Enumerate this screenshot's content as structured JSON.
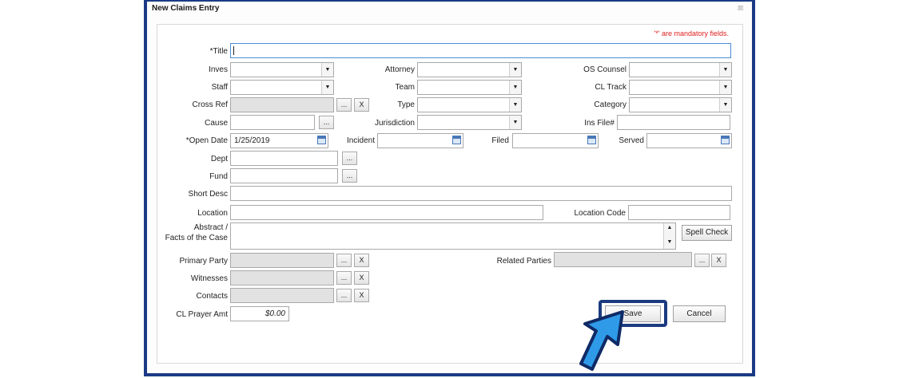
{
  "window": {
    "title": "New Claims Entry",
    "close_glyph": "☒"
  },
  "mandatory_note": "'*' are mandatory fields.",
  "fields": {
    "title": {
      "label": "*Title",
      "value": ""
    },
    "inves": {
      "label": "Inves"
    },
    "attorney": {
      "label": "Attorney"
    },
    "os_counsel": {
      "label": "OS Counsel"
    },
    "staff": {
      "label": "Staff"
    },
    "team": {
      "label": "Team"
    },
    "cl_track": {
      "label": "CL Track"
    },
    "cross_ref": {
      "label": "Cross Ref"
    },
    "type": {
      "label": "Type"
    },
    "category": {
      "label": "Category"
    },
    "cause": {
      "label": "Cause"
    },
    "jurisdiction": {
      "label": "Jurisdiction"
    },
    "ins_file": {
      "label": "Ins File#"
    },
    "open_date": {
      "label": "*Open Date",
      "value": "1/25/2019"
    },
    "incident": {
      "label": "Incident"
    },
    "filed": {
      "label": "Filed"
    },
    "served": {
      "label": "Served"
    },
    "dept": {
      "label": "Dept"
    },
    "fund": {
      "label": "Fund"
    },
    "short_desc": {
      "label": "Short Desc"
    },
    "location": {
      "label": "Location"
    },
    "location_code": {
      "label": "Location Code"
    },
    "abstract": {
      "label_line1": "Abstract /",
      "label_line2": "Facts of the Case"
    },
    "primary_party": {
      "label": "Primary Party"
    },
    "related_parties": {
      "label": "Related Parties"
    },
    "witnesses": {
      "label": "Witnesses"
    },
    "contacts": {
      "label": "Contacts"
    },
    "cl_prayer_amt": {
      "label": "CL Prayer Amt",
      "value": "$0.00"
    }
  },
  "buttons": {
    "browse": "...",
    "clear": "X",
    "spell_check": "Spell Check",
    "save": "Save",
    "cancel": "Cancel"
  },
  "icons": {
    "dropdown": "▼",
    "scroll_up": "▲",
    "scroll_down": "▼"
  },
  "colors": {
    "window_border": "#1b3a85",
    "mandatory_text": "#e02020",
    "highlight": "#1c3b80",
    "arrow_fill": "#2f9be8"
  }
}
